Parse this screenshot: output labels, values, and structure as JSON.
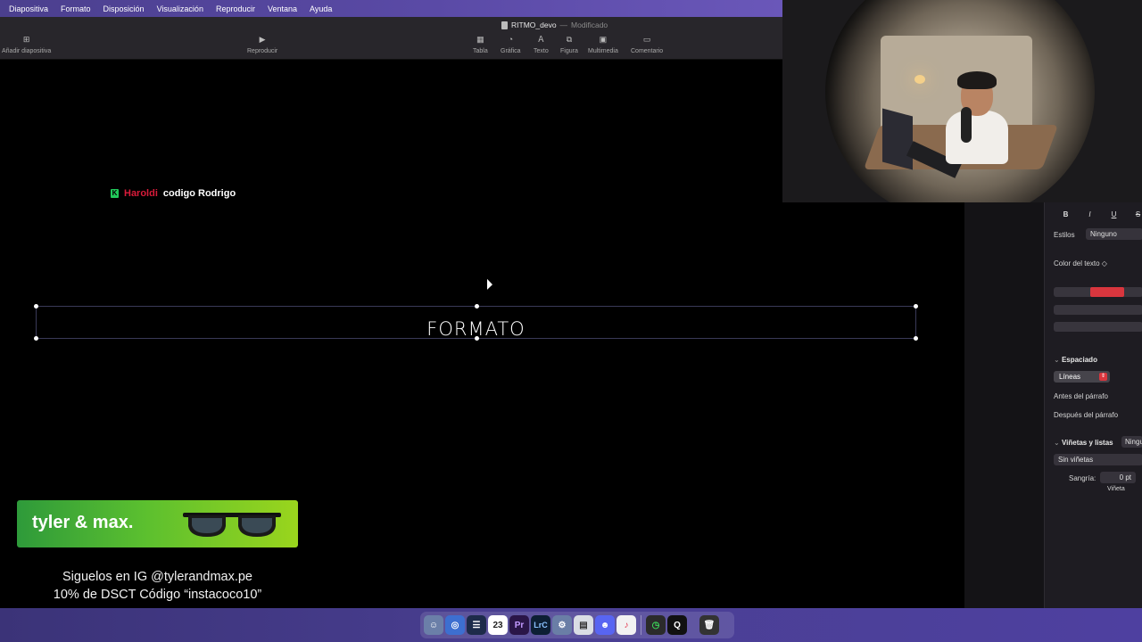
{
  "menu": [
    "Diapositiva",
    "Formato",
    "Disposición",
    "Visualización",
    "Reproducir",
    "Ventana",
    "Ayuda"
  ],
  "document": {
    "name": "RITMO_devo",
    "separator": "—",
    "status": "Modificado"
  },
  "toolbar": {
    "add_slide": "Añadir diapositiva",
    "play": "Reproducir",
    "table": "Tabla",
    "chart": "Gráfica",
    "text": "Texto",
    "shape": "Figura",
    "media": "Multimedia",
    "comment": "Comentario"
  },
  "slide": {
    "brand_icon": "K",
    "brand_name": "Haroldi",
    "brand_subtitle": "codigo Rodrigo",
    "textbox_text": "FORMATO"
  },
  "sponsor": {
    "name": "tyler & max.",
    "line1": "Siguelos en IG @tylerandmax.pe",
    "line2": "10% de DSCT Código “instacoco10”"
  },
  "inspector": {
    "format_buttons": [
      "B",
      "I",
      "U",
      "S"
    ],
    "styles_label": "Estilos",
    "styles_value": "Ninguno",
    "text_color_label": "Color del texto ◇",
    "spacing_header": "Espaciado",
    "spacing_value": "Líneas",
    "before_paragraph": "Antes del párrafo",
    "after_paragraph": "Después del párrafo",
    "bullets_header": "Viñetas y listas",
    "bullets_value": "Ningu",
    "no_bullets": "Sin viñetas",
    "indent_label": "Sangría:",
    "indent_value": "0 pt",
    "bullet_label": "Viñeta"
  },
  "dock": {
    "calendar_day": "23",
    "premiere": "Pr",
    "lightroom": "LrC"
  },
  "colors": {
    "accent_red": "#d9363e",
    "menubar": "#5a4aa6",
    "brand_green": "#21c95a"
  }
}
